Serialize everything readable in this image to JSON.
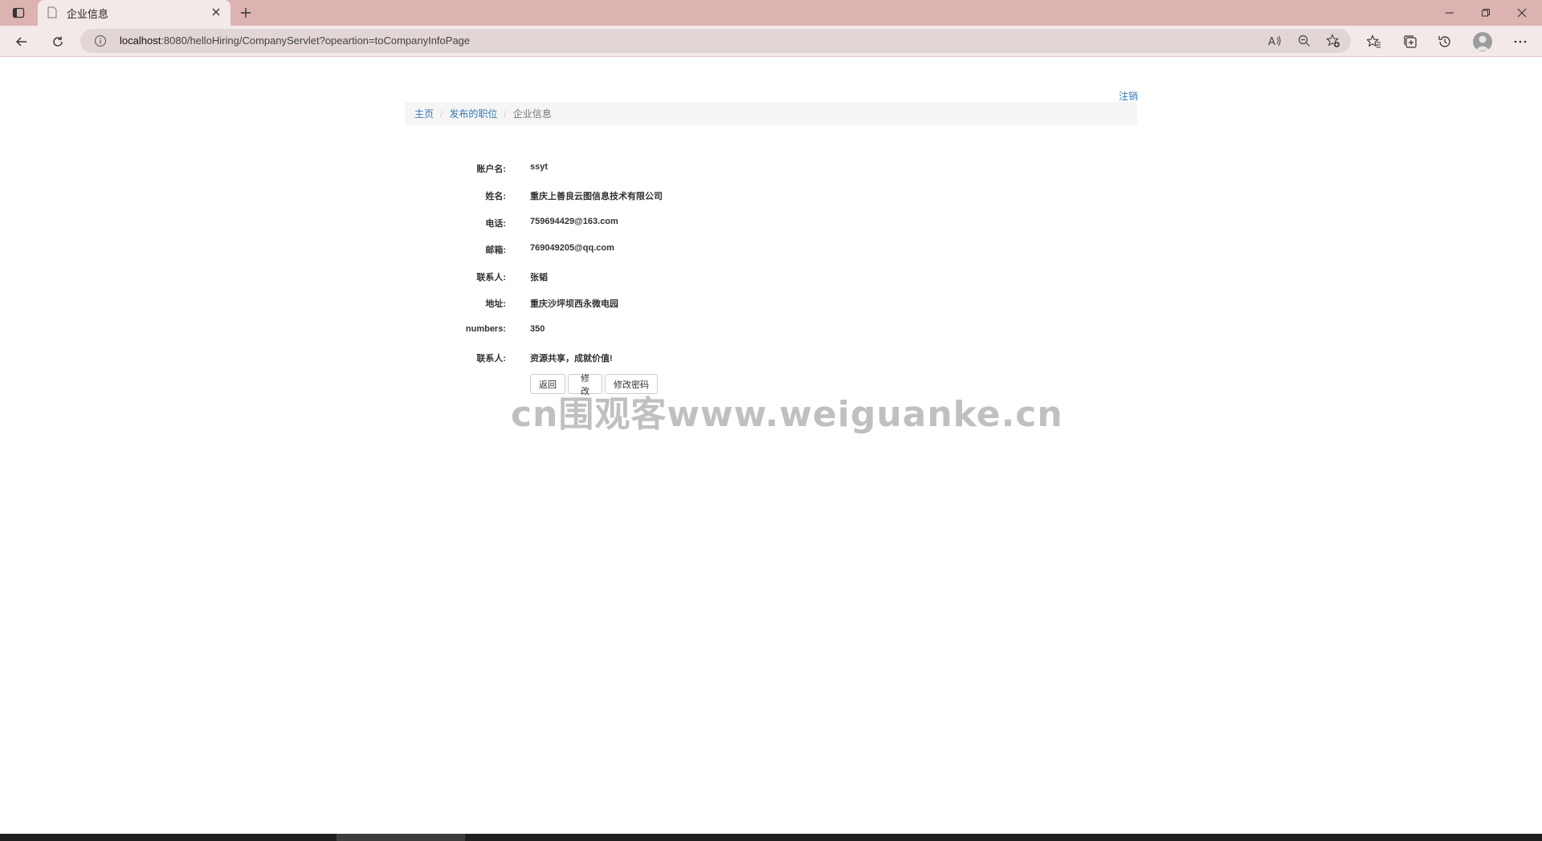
{
  "browser": {
    "tab_title": "企业信息",
    "url_host": "localhost",
    "url_rest": ":8080/helloHiring/CompanyServlet?opeartion=toCompanyInfoPage",
    "icons": [
      "sidebar-icon",
      "page-icon",
      "close-icon",
      "plus-icon",
      "minimize-icon",
      "restore-icon",
      "close-window-icon",
      "back-icon",
      "refresh-icon",
      "info-icon",
      "read-aloud-icon",
      "zoom-out-icon",
      "add-favorite-icon",
      "favorites-icon",
      "collections-icon",
      "history-icon",
      "profile-avatar-icon",
      "more-icon"
    ]
  },
  "page": {
    "logout": "注销",
    "breadcrumb": {
      "home": "主页",
      "jobs": "发布的职位",
      "current": "企业信息",
      "separator": "/"
    },
    "fields": [
      {
        "label": "账户名:",
        "value": "ssyt"
      },
      {
        "label": "姓名:",
        "value": "重庆上善良云图信息技术有限公司"
      },
      {
        "label": "电话:",
        "value": "759694429@163.com"
      },
      {
        "label": "邮箱:",
        "value": "769049205@qq.com"
      },
      {
        "label": "联系人:",
        "value": "张韬"
      },
      {
        "label": "地址:",
        "value": "重庆沙坪坝西永微电园"
      },
      {
        "label": "numbers:",
        "value": "350"
      },
      {
        "label": "联系人:",
        "value": "资源共享，成就价值!"
      }
    ],
    "buttons": {
      "back": "返回",
      "edit": "修改",
      "change_password": "修改密码"
    },
    "watermark": "cn围观客www.weiguanke.cn"
  }
}
